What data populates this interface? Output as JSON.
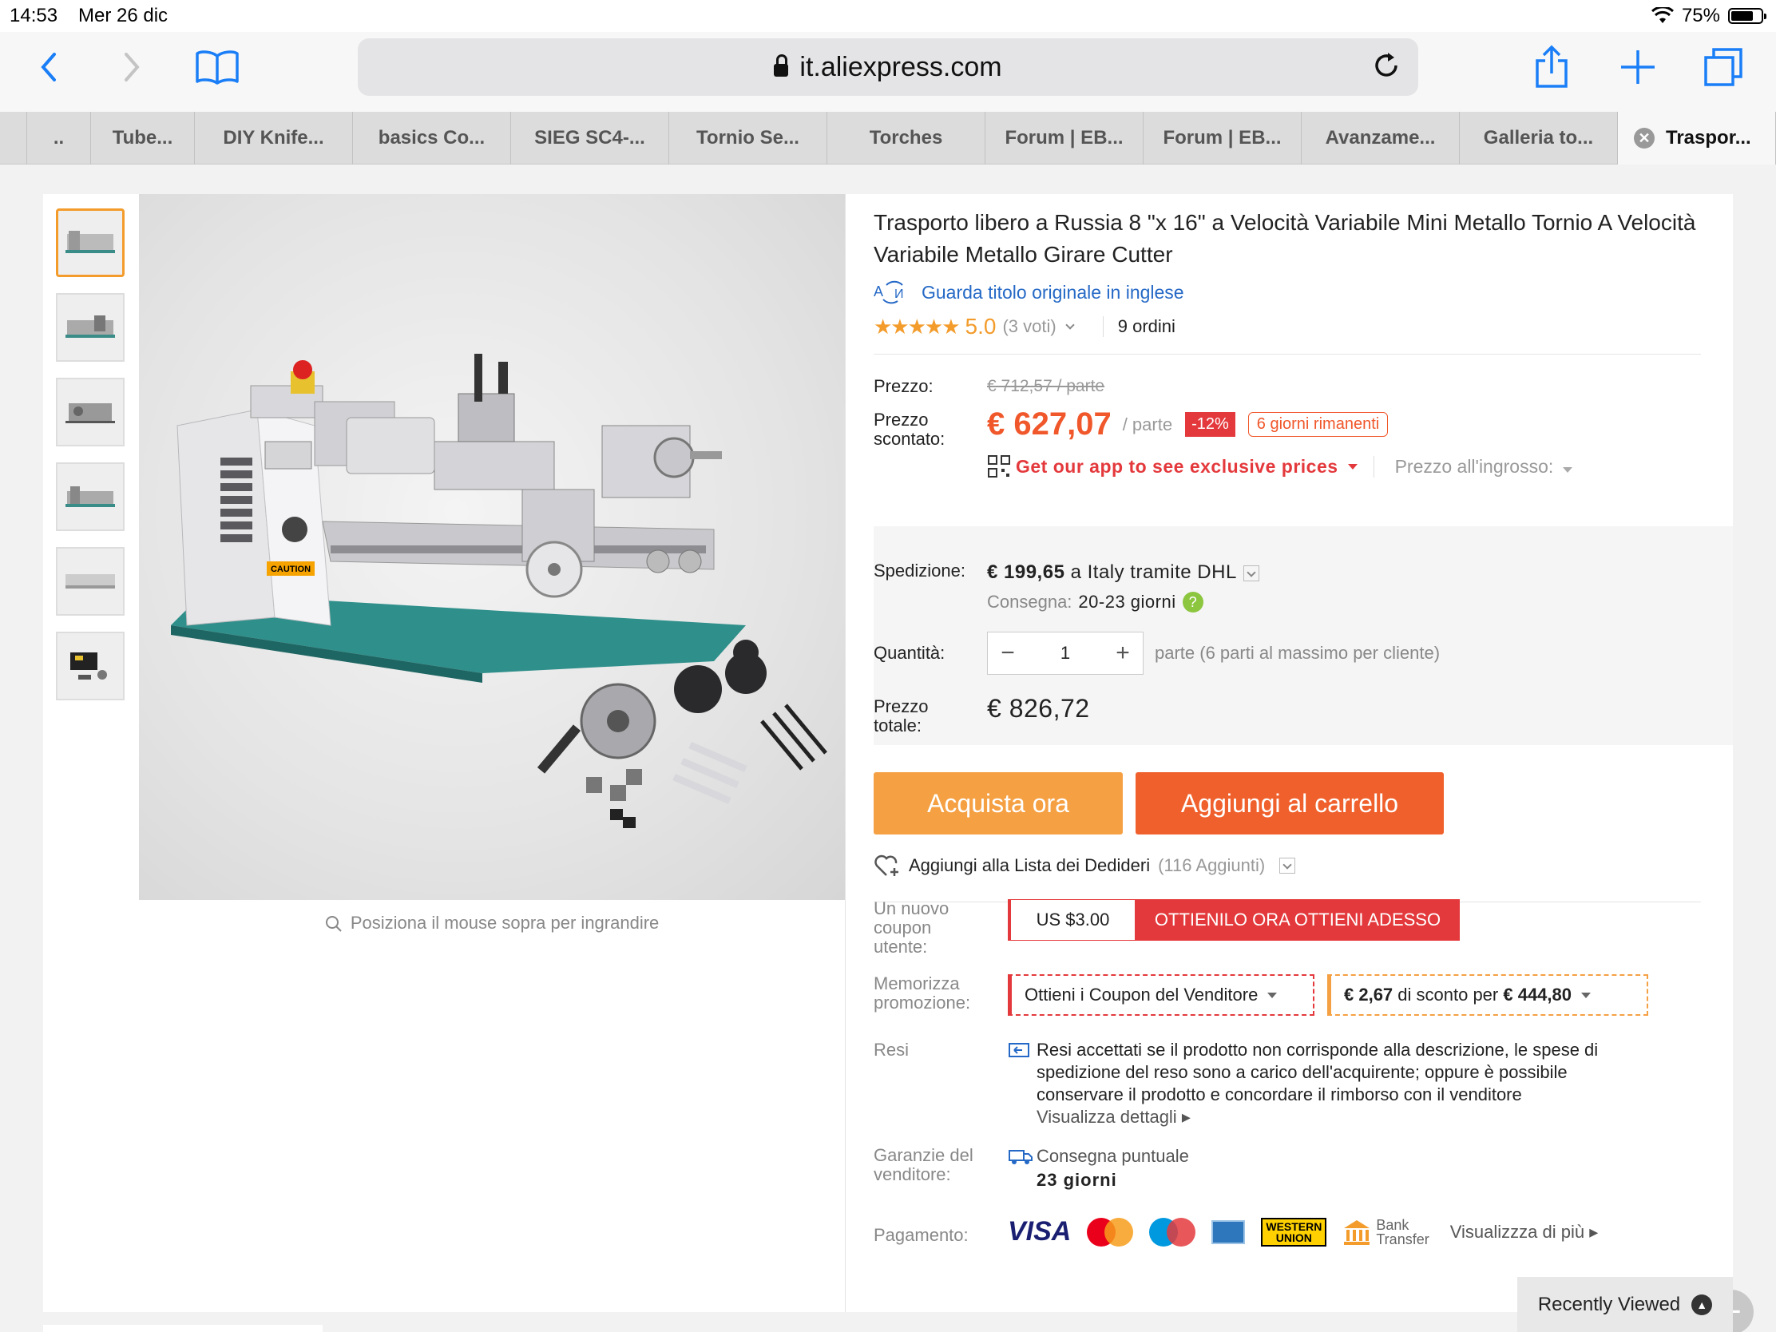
{
  "status": {
    "time": "14:53",
    "date": "Mer 26 dic",
    "battery": "75%",
    "battery_level": 0.75
  },
  "browser": {
    "url": "it.aliexpress.com",
    "tabs": [
      {
        "label": ".."
      },
      {
        "label": "Tube..."
      },
      {
        "label": "DIY Knife..."
      },
      {
        "label": "basics Co..."
      },
      {
        "label": "SIEG SC4-..."
      },
      {
        "label": "Tornio Se..."
      },
      {
        "label": "Torches"
      },
      {
        "label": "Forum | EB..."
      },
      {
        "label": "Forum | EB..."
      },
      {
        "label": "Avanzame..."
      },
      {
        "label": "Galleria to..."
      },
      {
        "label": "Traspor..."
      }
    ]
  },
  "gallery": {
    "zoom_hint": "Posiziona il mouse sopra per ingrandire",
    "selected_index": 0,
    "thumb_count": 6
  },
  "product": {
    "title": "Trasporto libero a Russia 8 \"x 16\" a Velocità Variabile Mini Metallo Tornio A Velocità Variabile Metallo Girare Cutter",
    "original_title_link": "Guarda titolo originale in inglese",
    "rating": "5.0",
    "rating_stars": 5,
    "votes": "(3 voti)",
    "orders": "9 ordini"
  },
  "pricing": {
    "price_label": "Prezzo:",
    "old_price": "€ 712,57 / parte",
    "discount_label": "Prezzo scontato:",
    "new_price": "€ 627,07",
    "unit": "/ parte",
    "discount": "-12%",
    "days_left": "6 giorni rimanenti",
    "app_promo": "Get our app to see exclusive prices",
    "wholesale": "Prezzo all'ingrosso:"
  },
  "shipping": {
    "label": "Spedizione:",
    "cost": "€ 199,65",
    "dest": " a Italy tramite DHL",
    "delivery_label": "Consegna:",
    "delivery_days": "20-23 giorni",
    "qty_label": "Quantità:",
    "qty": "1",
    "qty_minus": "−",
    "qty_plus": "+",
    "qty_note": "parte (6 parti al massimo per cliente)",
    "total_label": "Prezzo totale:",
    "total": "€ 826,72"
  },
  "actions": {
    "buy": "Acquista ora",
    "cart": "Aggiungi al carrello",
    "wishlist": "Aggiungi alla Lista dei Dedideri",
    "wishlist_count": "(116 Aggiunti)"
  },
  "coupons": {
    "new_user_label": "Un nuovo coupon utente:",
    "new_user_amount": "US $3.00",
    "new_user_cta": "OTTIENILO ORA OTTIENI ADESSO",
    "promo_label": "Memorizza promozione:",
    "seller_coupon": "Ottieni i Coupon del Venditore",
    "promo_discount": "€ 2,67",
    "promo_mid": " di sconto per ",
    "promo_threshold": "€ 444,80"
  },
  "returns": {
    "label": "Resi",
    "text": "Resi accettati se il prodotto non corrisponde alla descrizione, le spese di spedizione del reso sono a carico dell'acquirente; oppure è possibile conservare il prodotto e concordare il rimborso con il venditore",
    "details": "Visualizza dettagli"
  },
  "guarantee": {
    "label": "Garanzie del venditore:",
    "line1": "Consegna puntuale",
    "line2": "23 giorni"
  },
  "payment": {
    "label": "Pagamento:",
    "visa": "VISA",
    "wu_1": "WESTERN",
    "wu_2": "UNION",
    "bank_1": "Bank",
    "bank_2": "Transfer",
    "more": "Visualizzza di più"
  },
  "recently_viewed": "Recently Viewed",
  "colors": {
    "orange": "#f39c2c",
    "red": "#e4393c",
    "buy": "#f5a043",
    "cart": "#f0602c",
    "link": "#2569c6",
    "ios_blue": "#1a7ef7"
  }
}
